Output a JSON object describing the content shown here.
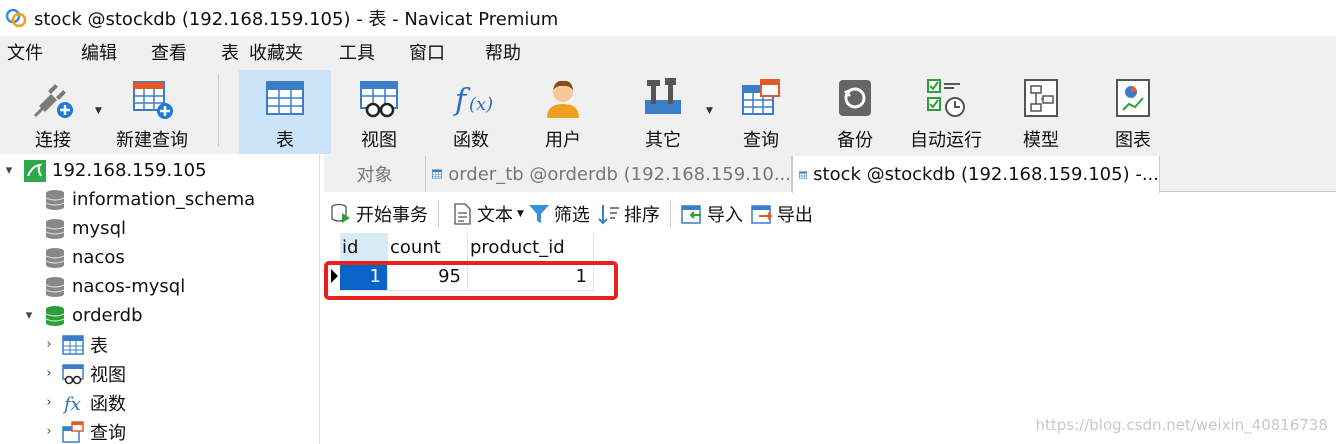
{
  "window": {
    "title": "stock @stockdb (192.168.159.105) - 表 - Navicat Premium"
  },
  "menu": [
    "文件",
    "编辑",
    "查看",
    "表",
    "收藏夹",
    "工具",
    "窗口",
    "帮助"
  ],
  "toolbar": {
    "connect": "连接",
    "new_query": "新建查询",
    "table": "表",
    "view": "视图",
    "function": "函数",
    "user": "用户",
    "other": "其它",
    "query": "查询",
    "backup": "备份",
    "automation": "自动运行",
    "model": "模型",
    "chart": "图表"
  },
  "sidebar": {
    "connection": "192.168.159.105",
    "databases": [
      "information_schema",
      "mysql",
      "nacos",
      "nacos-mysql",
      "orderdb"
    ],
    "orderdb_children": [
      "表",
      "视图",
      "函数",
      "查询"
    ]
  },
  "tabs": {
    "objects": "对象",
    "tab1": "order_tb @orderdb (192.168.159.10...",
    "tab2": "stock @stockdb (192.168.159.105) -..."
  },
  "subtoolbar": {
    "begin_transaction": "开始事务",
    "text": "文本",
    "filter": "筛选",
    "sort": "排序",
    "import": "导入",
    "export": "导出"
  },
  "grid": {
    "columns": [
      "id",
      "count",
      "product_id"
    ],
    "rows": [
      [
        "1",
        "95",
        "1"
      ]
    ]
  },
  "watermark": "https://blog.csdn.net/weixin_40816738",
  "colors": {
    "accent": "#0a64c8",
    "highlight": "#e8201e",
    "db_green": "#2e9e3a"
  }
}
